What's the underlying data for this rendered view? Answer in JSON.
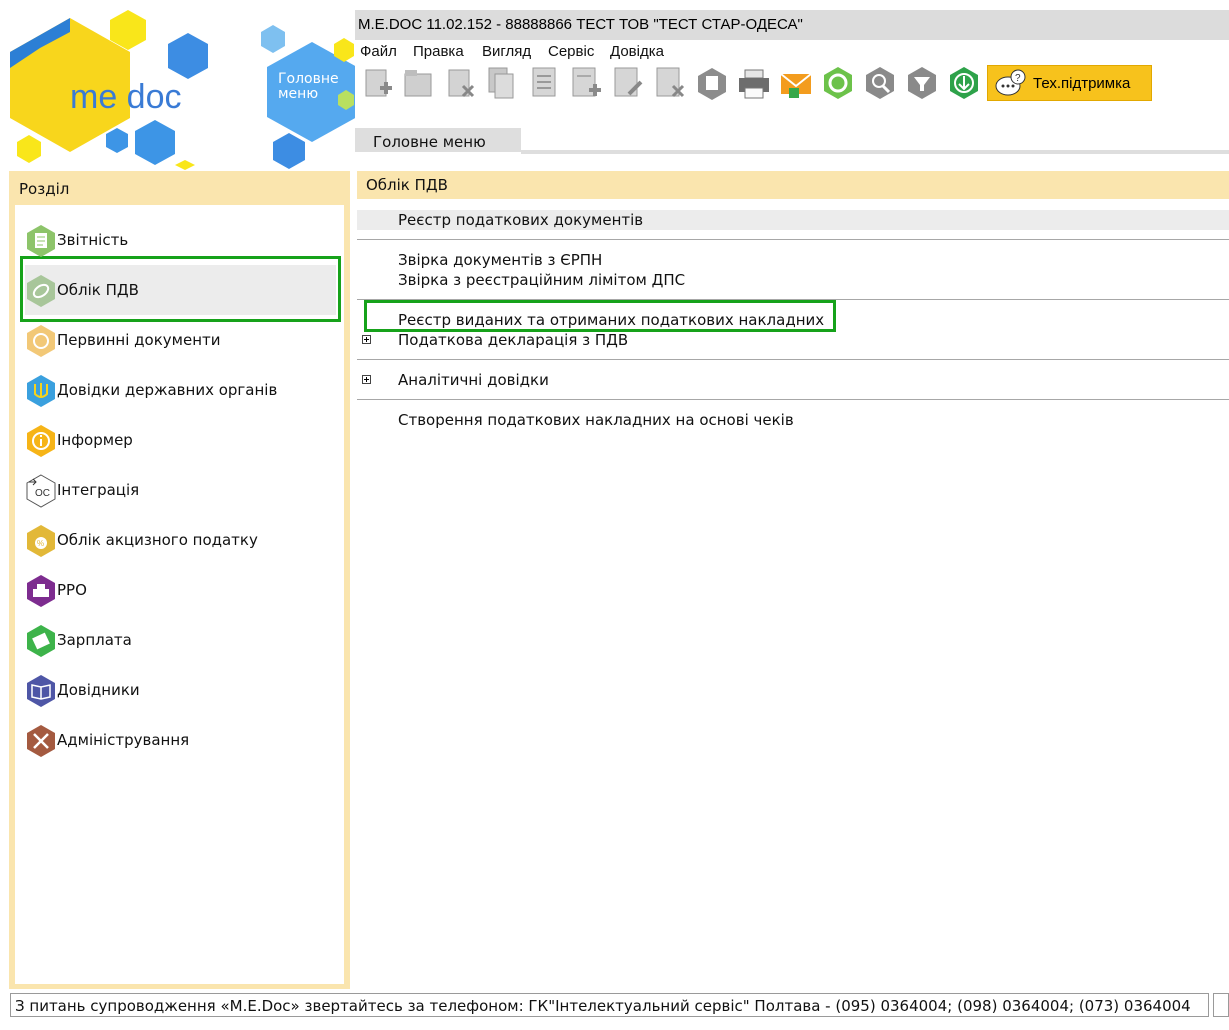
{
  "window": {
    "title": "M.E.DOC 11.02.152  - 88888866 ТЕСТ ТОВ \"ТЕСТ СТАР-ОДЕСА\""
  },
  "logo": {
    "brand": "me doc",
    "main_menu_hex": "Головне меню"
  },
  "menu": [
    "Файл",
    "Правка",
    "Вигляд",
    "Сервіс",
    "Довідка"
  ],
  "toolbar": {
    "icons": [
      "new-doc-icon",
      "open-doc-icon",
      "delete-doc-icon",
      "copy-doc-icon",
      "copy-list-icon",
      "add-list-icon",
      "edit-list-icon",
      "remove-list-icon",
      "archive-icon",
      "print-icon",
      "send-icon",
      "sync-icon",
      "search-icon",
      "filter-icon",
      "download-icon"
    ],
    "support_label": "Тех.підтримка"
  },
  "tab": {
    "label": "Головне меню"
  },
  "sidebar": {
    "header": "Розділ",
    "items": [
      {
        "label": "Звітність",
        "icon": "report-icon",
        "color": "#8dc46a"
      },
      {
        "label": "Облік ПДВ",
        "icon": "vat-icon",
        "color": "#a8c69a"
      },
      {
        "label": "Первинні документи",
        "icon": "primary-docs-icon",
        "color": "#f2c877"
      },
      {
        "label": "Довідки державних органів",
        "icon": "trident-icon",
        "color": "#3aa0de"
      },
      {
        "label": "Інформер",
        "icon": "info-icon",
        "color": "#f6b417"
      },
      {
        "label": "Інтеграція",
        "icon": "integration-icon",
        "color": "#ffffff"
      },
      {
        "label": "Облік акцизного податку",
        "icon": "excise-icon",
        "color": "#e2b838"
      },
      {
        "label": "РРО",
        "icon": "cash-register-icon",
        "color": "#7d2c8f"
      },
      {
        "label": "Зарплата",
        "icon": "salary-icon",
        "color": "#3db34a"
      },
      {
        "label": "Довідники",
        "icon": "book-icon",
        "color": "#4e56a6"
      },
      {
        "label": "Адміністрування",
        "icon": "tools-icon",
        "color": "#a45a40"
      }
    ]
  },
  "main": {
    "header": "Облік ПДВ",
    "items": [
      "Реєстр податкових документів",
      "Звірка документів з ЄРПН",
      "Звірка з реєстраційним лімітом ДПС",
      "Реєстр виданих та отриманих податкових накладних",
      "Податкова декларація з ПДВ",
      "Аналітичні довідки",
      "Створення податкових накладних на основі чеків"
    ]
  },
  "status": {
    "text": "З питань супроводження «M.E.Doc» звертайтесь за телефоном: ГК\"Інтелектуальний сервіс\" Полтава - (095) 0364004;  (098) 0364004;  (073) 0364004"
  },
  "colors": {
    "accent_yellow": "#fae5ae",
    "highlight_green": "#16a21a",
    "brand_yellow": "#f7d019",
    "brand_blue": "#3b8fe0"
  }
}
